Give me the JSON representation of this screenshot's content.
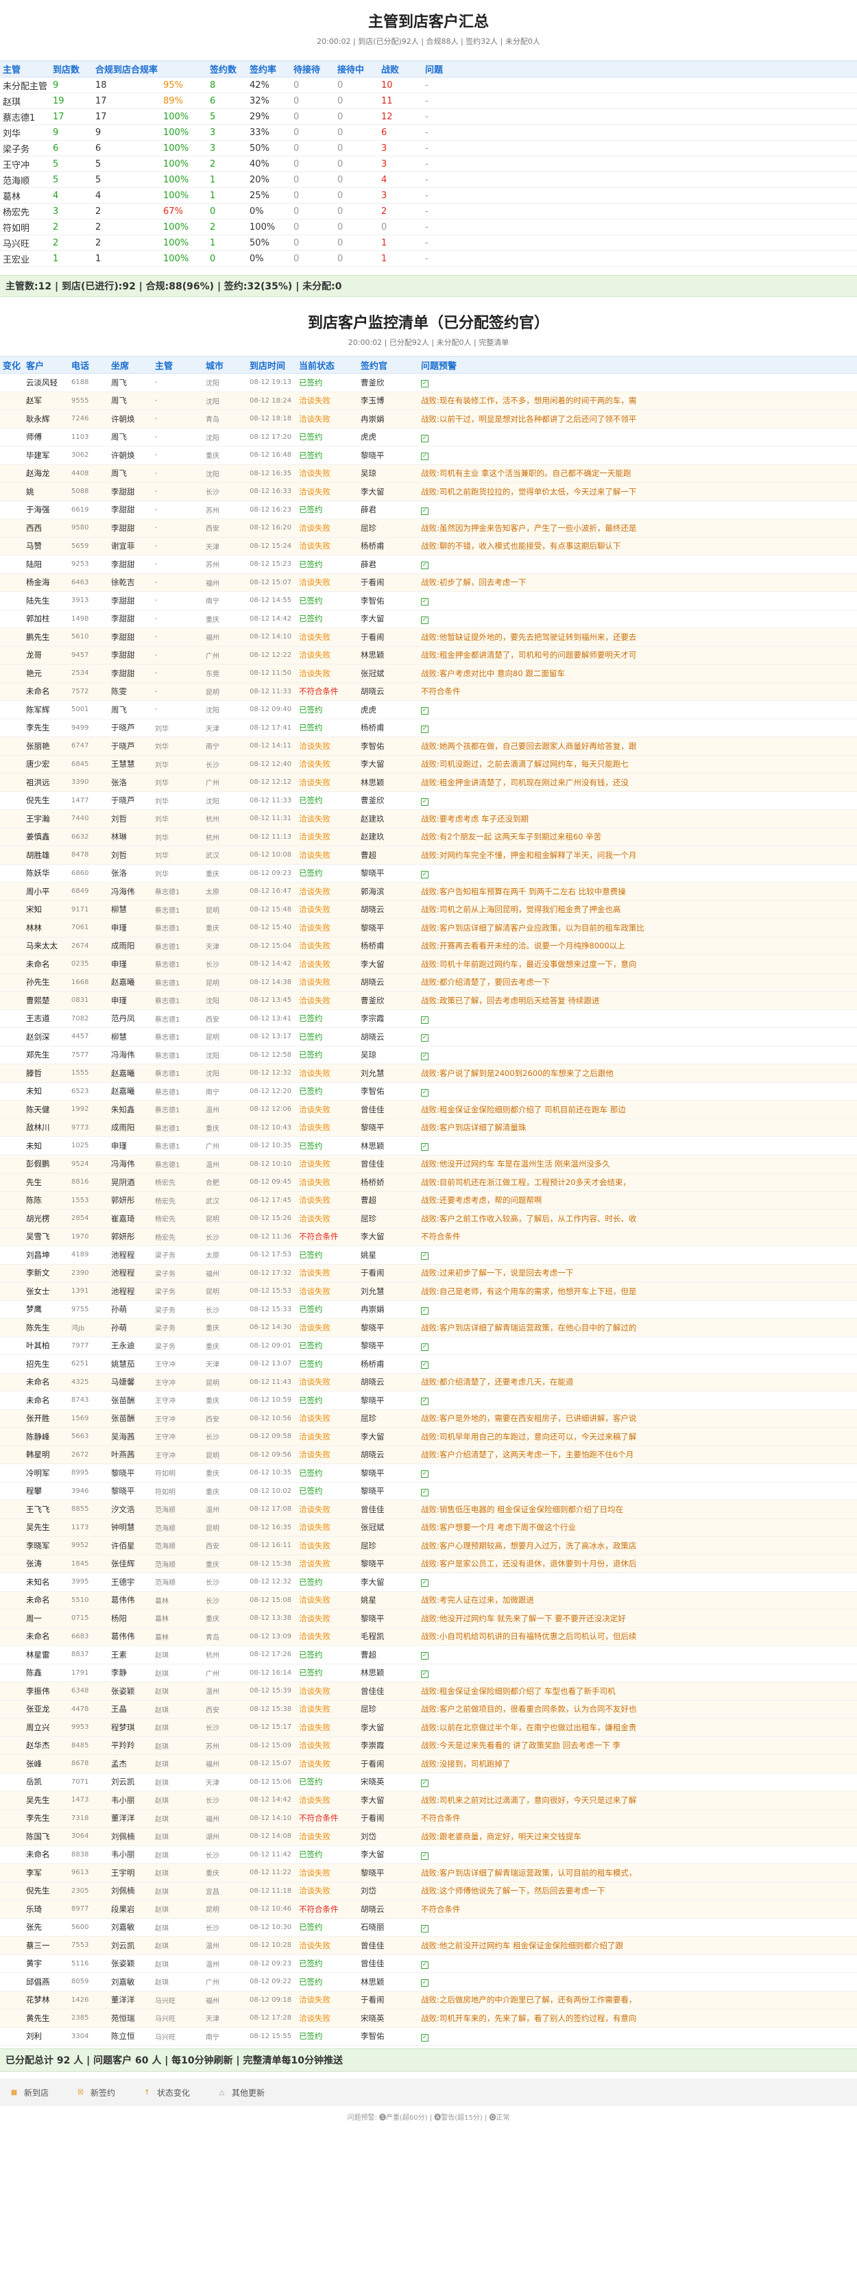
{
  "summary": {
    "title": "主管到店客户汇总",
    "subtitle": "20:00:02 | 到店(已分配)92人 | 合规88人 | 签约32人 | 未分配0人",
    "headers": [
      "主管",
      "到店数",
      "合规到店合规率",
      "",
      "签约数",
      "签约率",
      "待接待",
      "接待中",
      "战败",
      "问题"
    ],
    "rows": [
      [
        "未分配主管",
        "9",
        "18",
        "95%",
        "8",
        "42%",
        "0",
        "0",
        "10",
        "-"
      ],
      [
        "赵琪",
        "19",
        "17",
        "89%",
        "6",
        "32%",
        "0",
        "0",
        "11",
        "-"
      ],
      [
        "蔡志德1",
        "17",
        "17",
        "100%",
        "5",
        "29%",
        "0",
        "0",
        "12",
        "-"
      ],
      [
        "刘华",
        "9",
        "9",
        "100%",
        "3",
        "33%",
        "0",
        "0",
        "6",
        "-"
      ],
      [
        "梁子务",
        "6",
        "6",
        "100%",
        "3",
        "50%",
        "0",
        "0",
        "3",
        "-"
      ],
      [
        "王守冲",
        "5",
        "5",
        "100%",
        "2",
        "40%",
        "0",
        "0",
        "3",
        "-"
      ],
      [
        "范海顺",
        "5",
        "5",
        "100%",
        "1",
        "20%",
        "0",
        "0",
        "4",
        "-"
      ],
      [
        "葛林",
        "4",
        "4",
        "100%",
        "1",
        "25%",
        "0",
        "0",
        "3",
        "-"
      ],
      [
        "杨宏先",
        "3",
        "2",
        "67%",
        "0",
        "0%",
        "0",
        "0",
        "2",
        "-"
      ],
      [
        "符如明",
        "2",
        "2",
        "100%",
        "2",
        "100%",
        "0",
        "0",
        "0",
        "-"
      ],
      [
        "马兴旺",
        "2",
        "2",
        "100%",
        "1",
        "50%",
        "0",
        "0",
        "1",
        "-"
      ],
      [
        "王宏业",
        "1",
        "1",
        "100%",
        "0",
        "0%",
        "0",
        "0",
        "1",
        "-"
      ]
    ],
    "totals": "主管数:12 | 到店(已进行):92 | 合规:88(96%) | 签约:32(35%) | 未分配:0"
  },
  "detail": {
    "title": "到店客户监控清单（已分配签约官）",
    "subtitle": "20:00:02 | 已分配92人 | 未分配0人 | 完整清单",
    "headers": [
      "变化",
      "客户",
      "电话",
      "坐席",
      "主管",
      "城市",
      "到店时间",
      "当前状态",
      "签约官",
      "问题预警"
    ],
    "rows": [
      [
        "",
        "云淡风轻",
        "6188",
        "周飞",
        "-",
        "沈阳",
        "08-12 19:13",
        "已签约",
        "曹釜欣",
        "✓"
      ],
      [
        "",
        "赵军",
        "9555",
        "周飞",
        "-",
        "沈阳",
        "08-12 18:24",
        "洽谈失败",
        "李玉博",
        "战败:现在有装修工作，活不多，想用闲着的时间干两的车，需"
      ],
      [
        "",
        "耿永辉",
        "7246",
        "许朝焕",
        "-",
        "青岛",
        "08-12 18:18",
        "洽谈失败",
        "冉崇娟",
        "战败:以前干过，明显是想对比各种都讲了之后还问了领不领平"
      ],
      [
        "",
        "师傅",
        "1103",
        "周飞",
        "-",
        "沈阳",
        "08-12 17:20",
        "已签约",
        "虎虎",
        "✓"
      ],
      [
        "",
        "毕建军",
        "3062",
        "许朝焕",
        "-",
        "重庆",
        "08-12 16:48",
        "已签约",
        "黎晓平",
        "✓"
      ],
      [
        "",
        "赵海龙",
        "4408",
        "周飞",
        "-",
        "沈阳",
        "08-12 16:35",
        "洽谈失败",
        "吴琼",
        "战败:司机有主业 拿这个活当兼职的。自己都不确定一天能跑"
      ],
      [
        "",
        "姚",
        "5088",
        "李甜甜",
        "-",
        "长沙",
        "08-12 16:33",
        "洽谈失败",
        "李大留",
        "战败:司机之前跑货拉拉的，觉得单价太低，今天过来了解一下"
      ],
      [
        "",
        "于海强",
        "6619",
        "李甜甜",
        "-",
        "苏州",
        "08-12 16:23",
        "已签约",
        "薛君",
        "✓"
      ],
      [
        "",
        "西西",
        "9580",
        "李甜甜",
        "-",
        "西安",
        "08-12 16:20",
        "洽谈失败",
        "屈珍",
        "战败:虽然因为押金来告知客户，产生了一些小波折，最终还是"
      ],
      [
        "",
        "马赞",
        "5659",
        "谢宜菲",
        "-",
        "天津",
        "08-12 15:24",
        "洽谈失败",
        "杨桥甫",
        "战败:聊的不错，收入模式也能接受，有点事这期后聊认下"
      ],
      [
        "",
        "陆阳",
        "9253",
        "李甜甜",
        "-",
        "苏州",
        "08-12 15:23",
        "已签约",
        "薛君",
        "✓"
      ],
      [
        "",
        "杨金海",
        "6463",
        "徐乾吉",
        "-",
        "福州",
        "08-12 15:07",
        "洽谈失败",
        "于看闹",
        "战败:初步了解，回去考虑一下"
      ],
      [
        "",
        "陆先生",
        "3913",
        "李甜甜",
        "-",
        "南宁",
        "08-12 14:55",
        "已签约",
        "李智佑",
        "✓"
      ],
      [
        "",
        "郭加柱",
        "1498",
        "李甜甜",
        "-",
        "重庆",
        "08-12 14:42",
        "已签约",
        "李大留",
        "✓"
      ],
      [
        "",
        "鹏先生",
        "5610",
        "李甜甜",
        "-",
        "福州",
        "08-12 14:10",
        "洽谈失败",
        "于看闹",
        "战败:他暂缺证提外地的，要先去把驾驶证转到福州来，还要去"
      ],
      [
        "",
        "龙哥",
        "9457",
        "李甜甜",
        "-",
        "广州",
        "08-12 12:22",
        "洽谈失败",
        "林思颖",
        "战败:租金押金都讲清楚了，司机和号的问题要解师要明天才可"
      ],
      [
        "",
        "艳元",
        "2534",
        "李甜甜",
        "-",
        "东莞",
        "08-12 11:50",
        "洽谈失败",
        "张冠斌",
        "战败:客户考虑对比中 意向80 跟二面留车"
      ],
      [
        "",
        "未命名",
        "7572",
        "陈雯",
        "-",
        "昆明",
        "08-12 11:33",
        "不符合条件",
        "胡晓云",
        "不符合条件"
      ],
      [
        "",
        "陈军辉",
        "5001",
        "周飞",
        "-",
        "沈阳",
        "08-12 09:40",
        "已签约",
        "虎虎",
        "✓"
      ],
      [
        "",
        "李先生",
        "9499",
        "于晓芦",
        "刘华",
        "天津",
        "08-12 17:41",
        "已签约",
        "杨桥甫",
        "✓"
      ],
      [
        "",
        "张丽艳",
        "6747",
        "于晓芦",
        "刘华",
        "南宁",
        "08-12 14:11",
        "洽谈失败",
        "李智佑",
        "战败:她两个孩都在做，自己要回去跟家人商量好再给答复，跟"
      ],
      [
        "",
        "唐少宏",
        "6845",
        "王慧慧",
        "刘华",
        "长沙",
        "08-12 12:40",
        "洽谈失败",
        "李大留",
        "战败:司机没跑过，之前去滴滴了解过网约车，每天只能跑七"
      ],
      [
        "",
        "祖洪远",
        "3390",
        "张洛",
        "刘华",
        "广州",
        "08-12 12:12",
        "洽谈失败",
        "林思颖",
        "战败:租金押金讲清楚了，司机现在刚过来广州没有钱，还没"
      ],
      [
        "",
        "倪先生",
        "1477",
        "于晓芦",
        "刘华",
        "沈阳",
        "08-12 11:33",
        "已签约",
        "曹釜欣",
        "✓"
      ],
      [
        "",
        "王宇瀚",
        "7440",
        "刘哲",
        "刘华",
        "杭州",
        "08-12 11:31",
        "洽谈失败",
        "赵建玖",
        "战败:要考虑考虑 车子还没到期"
      ],
      [
        "",
        "姜慎鑫",
        "6632",
        "林琳",
        "刘华",
        "杭州",
        "08-12 11:13",
        "洽谈失败",
        "赵建玖",
        "战败:有2个朋友一起 这两天车子到期过来租60 辛苦"
      ],
      [
        "",
        "胡胜雄",
        "8478",
        "刘哲",
        "刘华",
        "武汉",
        "08-12 10:08",
        "洽谈失败",
        "曹超",
        "战败:对网约车完全不懂，押金和租金解释了半天，问我一个月"
      ],
      [
        "",
        "陈妖华",
        "6860",
        "张洛",
        "刘华",
        "重庆",
        "08-12 09:23",
        "已签约",
        "黎晓平",
        "✓"
      ],
      [
        "",
        "周小平",
        "6849",
        "冯海伟",
        "蔡志德1",
        "太原",
        "08-12 16:47",
        "洽谈失败",
        "郭海滨",
        "战败:客户告知租车预算在两千 到两千二左右 比较中意费操"
      ],
      [
        "",
        "宋知",
        "9171",
        "柳慧",
        "蔡志德1",
        "昆明",
        "08-12 15:48",
        "洽谈失败",
        "胡晓云",
        "战败:司机之前从上海回昆明，觉得我们租金贵了押金也高"
      ],
      [
        "",
        "林林",
        "7061",
        "申瑾",
        "蔡志德1",
        "重庆",
        "08-12 15:40",
        "洽谈失败",
        "黎晓平",
        "战败:客户到店详细了解清客户业应政策，以为目前的租车政策比"
      ],
      [
        "",
        "马来太太",
        "2674",
        "成雨阳",
        "蔡志德1",
        "天津",
        "08-12 15:04",
        "洽谈失败",
        "杨桥甫",
        "战败:开赛再去看看开未经的洽。说要一个月纯挣8000以上"
      ],
      [
        "",
        "未命名",
        "0235",
        "申瑾",
        "蔡志德1",
        "长沙",
        "08-12 14:42",
        "洽谈失败",
        "李大留",
        "战败:司机十年前跑过网约车，最近没事做想来过度一下，意向"
      ],
      [
        "",
        "孙先生",
        "1668",
        "赵嘉曦",
        "蔡志德1",
        "昆明",
        "08-12 14:38",
        "洽谈失败",
        "胡晓云",
        "战败:都介绍清楚了，要回去考虑一下"
      ],
      [
        "",
        "曹熙楚",
        "0831",
        "申瑾",
        "蔡志德1",
        "沈阳",
        "08-12 13:45",
        "洽谈失败",
        "曹釜欣",
        "战败:政策已了解，回去考虑明后天给答复 待续跟进"
      ],
      [
        "",
        "王志道",
        "7082",
        "范丹凤",
        "蔡志德1",
        "西安",
        "08-12 13:41",
        "已签约",
        "李宗霞",
        "✓"
      ],
      [
        "",
        "赵剑深",
        "4457",
        "柳慧",
        "蔡志德1",
        "昆明",
        "08-12 13:17",
        "已签约",
        "胡晓云",
        "✓"
      ],
      [
        "",
        "郑先生",
        "7577",
        "冯海伟",
        "蔡志德1",
        "沈阳",
        "08-12 12:58",
        "已签约",
        "吴琼",
        "✓"
      ],
      [
        "",
        "滕哲",
        "1555",
        "赵嘉曦",
        "蔡志德1",
        "沈阳",
        "08-12 12:32",
        "洽谈失败",
        "刘允慧",
        "战败:客户说了解到是2400到2600的车想来了之后跟他"
      ],
      [
        "",
        "未知",
        "6523",
        "赵嘉曦",
        "蔡志德1",
        "南宁",
        "08-12 12:20",
        "已签约",
        "李智佑",
        "✓"
      ],
      [
        "",
        "陈天健",
        "1992",
        "朱知鑫",
        "蔡志德1",
        "温州",
        "08-12 12:06",
        "洽谈失败",
        "曾佳佳",
        "战败:租金保证金保险细则都介绍了 司机目前还在跑车 那边"
      ],
      [
        "",
        "敌林川",
        "9773",
        "成雨阳",
        "蔡志德1",
        "重庆",
        "08-12 10:43",
        "洽谈失败",
        "黎晓平",
        "战败:客户到店详细了解清量珠"
      ],
      [
        "",
        "未知",
        "1025",
        "申瑾",
        "蔡志德1",
        "广州",
        "08-12 10:35",
        "已签约",
        "林思颖",
        "✓"
      ],
      [
        "",
        "彭假鹏",
        "9524",
        "冯海伟",
        "蔡志德1",
        "温州",
        "08-12 10:10",
        "洽谈失败",
        "曾佳佳",
        "战败:他没开过网约车 车是在温州生活 刚来温州没多久"
      ],
      [
        "",
        "先生",
        "8816",
        "晃阴酒",
        "杨宏先",
        "合肥",
        "08-12 09:45",
        "洽谈失败",
        "杨桥娇",
        "战败:目前司机还在浙江做工程，工程预计20多天才会结束，"
      ],
      [
        "",
        "陈陈",
        "1553",
        "郭妍彤",
        "杨宏先",
        "武汉",
        "08-12 17:45",
        "洽谈失败",
        "曹超",
        "战败:还要考虑考虑，帮的问题帮啊"
      ],
      [
        "",
        "胡光楞",
        "2854",
        "崔嘉琦",
        "杨宏先",
        "昆明",
        "08-12 15:26",
        "洽谈失败",
        "屈珍",
        "战败:客户之前工作收入较高，了解后，从工作内容、时长、收"
      ],
      [
        "",
        "吴雪飞",
        "1970",
        "郭妍彤",
        "杨宏先",
        "长沙",
        "08-12 11:36",
        "不符合条件",
        "李大留",
        "不符合条件"
      ],
      [
        "",
        "刘昌坤",
        "4189",
        "池程程",
        "梁子务",
        "太原",
        "08-12 17:53",
        "已签约",
        "姚星",
        "✓"
      ],
      [
        "",
        "李新文",
        "2390",
        "池程程",
        "梁子务",
        "福州",
        "08-12 17:32",
        "洽谈失败",
        "于看闹",
        "战败:过来初步了解一下，说是回去考虑一下"
      ],
      [
        "",
        "张女士",
        "1391",
        "池程程",
        "梁子务",
        "昆明",
        "08-12 15:53",
        "洽谈失败",
        "刘允慧",
        "战败:自己是老师，有这个用车的需求，他想开车上下班，但是"
      ],
      [
        "",
        "梦鹰",
        "9755",
        "孙萌",
        "梁子务",
        "长沙",
        "08-12 15:33",
        "已签约",
        "冉崇娟",
        "✓"
      ],
      [
        "",
        "陈先生",
        "鸿Jb",
        "孙萌",
        "梁子务",
        "重庆",
        "08-12 14:30",
        "洽谈失败",
        "黎晓平",
        "战败:客户到店详细了解青瑞运营政策，在他心目中的了解过的"
      ],
      [
        "",
        "叶其柏",
        "7977",
        "王永迪",
        "梁子务",
        "重庆",
        "08-12 09:01",
        "已签约",
        "黎晓平",
        "✓"
      ],
      [
        "",
        "招先生",
        "6251",
        "姚慧茄",
        "王守冲",
        "天津",
        "08-12 13:07",
        "已签约",
        "杨桥甫",
        "✓"
      ],
      [
        "",
        "未命名",
        "4325",
        "马婕馨",
        "王守冲",
        "昆明",
        "08-12 11:43",
        "洽谈失败",
        "胡晓云",
        "战败:都介绍清楚了，还要考虑几天，在能道"
      ],
      [
        "",
        "未命名",
        "8743",
        "张苗酬",
        "王守冲",
        "重庆",
        "08-12 10:59",
        "已签约",
        "黎晓平",
        "✓"
      ],
      [
        "",
        "张开胜",
        "1569",
        "张苗酬",
        "王守冲",
        "西安",
        "08-12 10:56",
        "洽谈失败",
        "屈珍",
        "战败:客户是外地的，需要在西安租房子，已讲细讲解，客户说"
      ],
      [
        "",
        "陈静峰",
        "5663",
        "吴海茜",
        "王守冲",
        "长沙",
        "08-12 09:58",
        "洽谈失败",
        "李大留",
        "战败:司机早年用自己的车跑过，意向还可以，今天过来稿了解"
      ],
      [
        "",
        "韩星明",
        "2672",
        "叶燕茜",
        "王守冲",
        "昆明",
        "08-12 09:56",
        "洽谈失败",
        "胡晓云",
        "战败:客户介绍清楚了，这两天考虑一下，主要怕跑不住6个月"
      ],
      [
        "",
        "冷明军",
        "8995",
        "黎晓平",
        "符如明",
        "重庆",
        "08-12 10:35",
        "已签约",
        "黎晓平",
        "✓"
      ],
      [
        "",
        "程攀",
        "3946",
        "黎晓平",
        "符如明",
        "重庆",
        "08-12 10:02",
        "已签约",
        "黎晓平",
        "✓"
      ],
      [
        "",
        "王飞飞",
        "8855",
        "汐文浩",
        "范海顺",
        "温州",
        "08-12 17:08",
        "洽谈失败",
        "曾佳佳",
        "战败:销售低压电器的 租金保证金保险细则都介绍了日均在"
      ],
      [
        "",
        "吴先生",
        "1173",
        "钟明慧",
        "范海顺",
        "昆明",
        "08-12 16:35",
        "洽谈失败",
        "张冠斌",
        "战败:客户想要一个月 考虑下周不做这个行业"
      ],
      [
        "",
        "李晓军",
        "9952",
        "许佰星",
        "范海顺",
        "西安",
        "08-12 16:11",
        "洽谈失败",
        "屈珍",
        "战败:客户心理预期较高，想要月入过万，洗了高冰水，政策店"
      ],
      [
        "",
        "张涛",
        "1845",
        "张佳辉",
        "范海顺",
        "重庆",
        "08-12 15:38",
        "洽谈失败",
        "黎晓平",
        "战败:客户是家公员工，还没有退休，退休要到十月份，退休后"
      ],
      [
        "",
        "未知名",
        "3995",
        "王德宇",
        "范海顺",
        "长沙",
        "08-12 12:32",
        "已签约",
        "李大留",
        "✓"
      ],
      [
        "",
        "未命名",
        "5510",
        "葛伟伟",
        "葛林",
        "长沙",
        "08-12 15:08",
        "洽谈失败",
        "姚星",
        "战败:考完人证在过来，加微跟进"
      ],
      [
        "",
        "周一",
        "0715",
        "杨阳",
        "葛林",
        "重庆",
        "08-12 13:38",
        "洽谈失败",
        "黎晓平",
        "战败:他没开过网约车 就先来了解一下 要不要开还没决定好"
      ],
      [
        "",
        "未命名",
        "6683",
        "葛伟伟",
        "葛林",
        "青岛",
        "08-12 13:09",
        "洽谈失败",
        "毛程凯",
        "战败:小自司机给司机讲的日有福特优惠之后司机认可，但后续"
      ],
      [
        "",
        "林星雷",
        "8837",
        "王素",
        "赵琪",
        "杭州",
        "08-12 17:26",
        "已签约",
        "曹超",
        "✓"
      ],
      [
        "",
        "陈鑫",
        "1791",
        "李静",
        "赵琪",
        "广州",
        "08-12 16:14",
        "已签约",
        "林思颖",
        "✓"
      ],
      [
        "",
        "李振伟",
        "6348",
        "张姿颖",
        "赵琪",
        "温州",
        "08-12 15:39",
        "洽谈失败",
        "曾佳佳",
        "战败:租金保证金保险细则都介绍了 车型也看了新手司机"
      ],
      [
        "",
        "张亚龙",
        "4478",
        "王晶",
        "赵琪",
        "西安",
        "08-12 15:38",
        "洽谈失败",
        "屈珍",
        "战败:客户之前做项目的，很看重合同条款，认为合同不友好也"
      ],
      [
        "",
        "周立兴",
        "9953",
        "程梦琪",
        "赵琪",
        "长沙",
        "08-12 15:17",
        "洽谈失败",
        "李大留",
        "战败:以前在北京做过半个年，在南宁也做过出租车，嫌租金贵"
      ],
      [
        "",
        "赵华杰",
        "8485",
        "平羚羚",
        "赵琪",
        "苏州",
        "08-12 15:09",
        "洽谈失败",
        "李崇霞",
        "战败:今天是过来先看看的 讲了政策奖励 回去考虑一下 李"
      ],
      [
        "",
        "张峰",
        "8678",
        "孟杰",
        "赵琪",
        "福州",
        "08-12 15:07",
        "洽谈失败",
        "于看闹",
        "战败:没接到，司机跑掉了"
      ],
      [
        "",
        "岳凯",
        "7071",
        "刘云凯",
        "赵琪",
        "天津",
        "08-12 15:06",
        "已签约",
        "宋晓英",
        "✓"
      ],
      [
        "",
        "吴先生",
        "1473",
        "韦小丽",
        "赵琪",
        "长沙",
        "08-12 14:42",
        "洽谈失败",
        "李大留",
        "战败:司机来之前对比过滴滴了，意向很好，今天只是过来了解"
      ],
      [
        "",
        "李先生",
        "7318",
        "董洋洋",
        "赵琪",
        "福州",
        "08-12 14:10",
        "不符合条件",
        "于看闹",
        "不符合条件"
      ],
      [
        "",
        "陈国飞",
        "3064",
        "刘佩楠",
        "赵琪",
        "湖州",
        "08-12 14:08",
        "洽谈失败",
        "刘岱",
        "战败:跟老婆商量，商定好，明天过来交钱提车"
      ],
      [
        "",
        "未命名",
        "8838",
        "韦小丽",
        "赵琪",
        "长沙",
        "08-12 11:42",
        "已签约",
        "李大留",
        "✓"
      ],
      [
        "",
        "李军",
        "9613",
        "王宇明",
        "赵琪",
        "重庆",
        "08-12 11:22",
        "洽谈失败",
        "黎晓平",
        "战败:客户到店详细了解青瑞运营政策，认可目前的租车模式，"
      ],
      [
        "",
        "倪先生",
        "2305",
        "刘佩楠",
        "赵琪",
        "宜昌",
        "08-12 11:18",
        "洽谈失败",
        "刘岱",
        "战败:这个师傅他说先了解一下，然后回去要考虑一下"
      ],
      [
        "",
        "乐琦",
        "8977",
        "段果岩",
        "赵琪",
        "昆明",
        "08-12 10:46",
        "不符合条件",
        "胡晓云",
        "不符合条件"
      ],
      [
        "",
        "张先",
        "5600",
        "刘嘉敏",
        "赵琪",
        "长沙",
        "08-12 10:30",
        "已签约",
        "石晓丽",
        "✓"
      ],
      [
        "",
        "蔡三一",
        "7553",
        "刘云凯",
        "赵琪",
        "温州",
        "08-12 10:28",
        "洽谈失败",
        "曾佳佳",
        "战败:他之前没开过网约车 租金保证金保险细则都介绍了跟"
      ],
      [
        "",
        "黄宇",
        "5116",
        "张姿颖",
        "赵琪",
        "温州",
        "08-12 09:23",
        "已签约",
        "曾佳佳",
        "✓"
      ],
      [
        "",
        "邱倡燕",
        "8059",
        "刘嘉敏",
        "赵琪",
        "广州",
        "08-12 09:22",
        "已签约",
        "林思颖",
        "✓"
      ],
      [
        "",
        "花梦林",
        "1426",
        "董洋洋",
        "马兴旺",
        "福州",
        "08-12 09:18",
        "洽谈失败",
        "于看闹",
        "战败:之后做房地产的中介跑里已了解，还有两份工作需要看，"
      ],
      [
        "",
        "黄先生",
        "2385",
        "苑恒瑞",
        "马兴旺",
        "天津",
        "08-12 17:28",
        "洽谈失败",
        "宋晓英",
        "战败:司机开车来的，先来了解，看了别人的签约过程，有意向"
      ],
      [
        "",
        "刘利",
        "3304",
        "陈立恒",
        "马兴旺",
        "南宁",
        "08-12 15:55",
        "已签约",
        "李智佑",
        "✓"
      ]
    ],
    "footer": "已分配总计 92 人 | 问题客户 60 人 | 每10分钟刷新 | 完整清单每10分钟推送",
    "legend": [
      {
        "icon": "new-store-icon",
        "label": "新到店",
        "color": "#e88c0b"
      },
      {
        "icon": "new-sign-icon",
        "label": "新签约",
        "color": "#e88c0b"
      },
      {
        "icon": "status-change-icon",
        "label": "状态变化",
        "color": "#e88c0b"
      },
      {
        "icon": "other-update-icon",
        "label": "其他更新",
        "color": "#999999"
      }
    ],
    "note": "问题预警: 🅢严重(超60分) | 🅐警告(超15分) | 🅞正常"
  }
}
